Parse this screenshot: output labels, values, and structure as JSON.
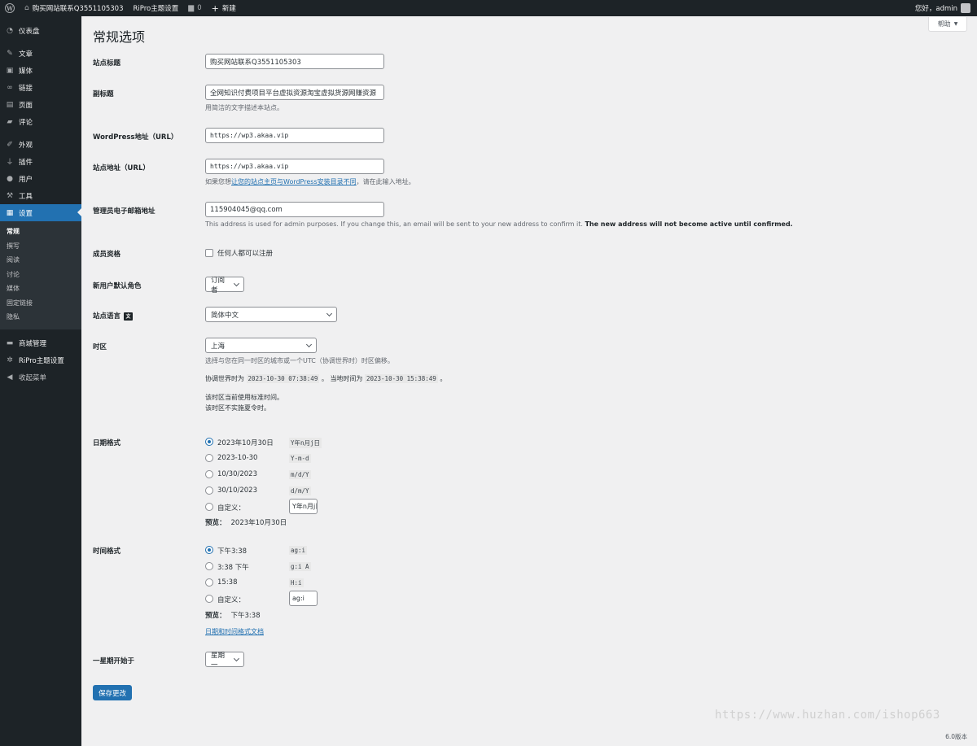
{
  "adminbar": {
    "site_name": "购买网站联系Q3551105303",
    "theme_settings": "RiPro主题设置",
    "comments_count": "0",
    "new_label": "新建",
    "greeting": "您好，admin"
  },
  "sidebar": {
    "items": [
      {
        "label": "仪表盘",
        "icon": "dashboard-icon"
      },
      {
        "label": "文章",
        "icon": "pin-icon"
      },
      {
        "label": "媒体",
        "icon": "media-icon"
      },
      {
        "label": "链接",
        "icon": "link-icon"
      },
      {
        "label": "页面",
        "icon": "page-icon"
      },
      {
        "label": "评论",
        "icon": "comment-icon"
      },
      {
        "label": "外观",
        "icon": "brush-icon"
      },
      {
        "label": "插件",
        "icon": "plugin-icon"
      },
      {
        "label": "用户",
        "icon": "user-icon"
      },
      {
        "label": "工具",
        "icon": "wrench-icon"
      },
      {
        "label": "设置",
        "icon": "settings-icon"
      },
      {
        "label": "商城管理",
        "icon": "shop-icon"
      },
      {
        "label": "RiPro主题设置",
        "icon": "gear-icon"
      },
      {
        "label": "收起菜单",
        "icon": "collapse-icon"
      }
    ],
    "submenu": [
      "常规",
      "撰写",
      "阅读",
      "讨论",
      "媒体",
      "固定链接",
      "隐私"
    ]
  },
  "help": "帮助",
  "page_title": "常规选项",
  "fields": {
    "site_title": {
      "label": "站点标题",
      "value": "购买网站联系Q3551105303"
    },
    "tagline": {
      "label": "副标题",
      "value": "全网知识付费项目平台虚拟资源淘宝虚拟货源网赚资源",
      "desc": "用简洁的文字描述本站点。"
    },
    "wp_url": {
      "label": "WordPress地址（URL）",
      "value": "https://wp3.akaa.vip"
    },
    "site_url": {
      "label": "站点地址（URL）",
      "value": "https://wp3.akaa.vip",
      "desc_pre": "如果您想",
      "desc_link": "让您的站点主页与WordPress安装目录不同",
      "desc_post": "，请在此输入地址。"
    },
    "admin_email": {
      "label": "管理员电子邮箱地址",
      "value": "115904045@qq.com",
      "desc_main": "This address is used for admin purposes. If you change this, an email will be sent to your new address to confirm it.",
      "desc_bold": "The new address will not become active until confirmed."
    },
    "membership": {
      "label": "成员资格",
      "checkbox_label": "任何人都可以注册"
    },
    "default_role": {
      "label": "新用户默认角色",
      "value": "订阅者"
    },
    "site_language": {
      "label": "站点语言",
      "value": "简体中文"
    },
    "timezone": {
      "label": "时区",
      "value": "上海",
      "desc": "选择与您在同一时区的城市或一个UTC（协调世界时）时区偏移。",
      "utc_label": "协调世界时为",
      "utc_time": "2023-10-30 07:38:49",
      "sep": "。",
      "local_label": "当地时间为",
      "local_time": "2023-10-30 15:38:49",
      "end": "。",
      "std_note": "该时区当前使用标准时间。",
      "dst_note": "该时区不实施夏令时。"
    },
    "date_format": {
      "label": "日期格式",
      "options": [
        {
          "label": "2023年10月30日",
          "code": "Y年n月j日"
        },
        {
          "label": "2023-10-30",
          "code": "Y-m-d"
        },
        {
          "label": "10/30/2023",
          "code": "m/d/Y"
        },
        {
          "label": "30/10/2023",
          "code": "d/m/Y"
        },
        {
          "label": "自定义：",
          "code": "Y年n月j日"
        }
      ],
      "preview_label": "预览：",
      "preview_value": "2023年10月30日"
    },
    "time_format": {
      "label": "时间格式",
      "options": [
        {
          "label": "下午3:38",
          "code": "ag:i"
        },
        {
          "label": "3:38 下午",
          "code": "g:i A"
        },
        {
          "label": "15:38",
          "code": "H:i"
        },
        {
          "label": "自定义：",
          "code": "ag:i"
        }
      ],
      "preview_label": "预览：",
      "preview_value": "下午3:38",
      "doc_link": "日期和时间格式文档"
    },
    "week_start": {
      "label": "一星期开始于",
      "value": "星期一"
    }
  },
  "save_button": "保存更改",
  "watermark": "https://www.huzhan.com/ishop663",
  "version": "6.0版本"
}
